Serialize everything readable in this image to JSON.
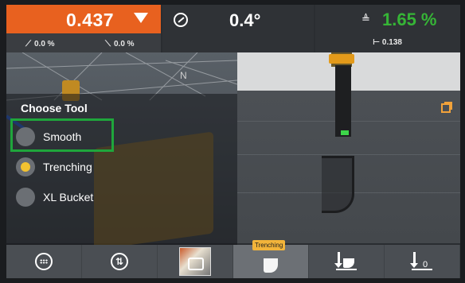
{
  "status_bar": {
    "elevation_value": "0.437",
    "cross_slope_left": "0.0 %",
    "cross_slope_right": "0.0 %",
    "heading_value": "0.4°",
    "grade_value": "1.65 %",
    "cross_distance": "0.138"
  },
  "view": {
    "north_label": "N"
  },
  "tool_menu": {
    "title": "Choose Tool",
    "options": [
      {
        "label": "Smooth",
        "selected": false
      },
      {
        "label": "Trenching",
        "selected": true
      },
      {
        "label": "XL Bucket",
        "selected": false
      }
    ]
  },
  "toolbar": {
    "active_tag": "Trenching"
  },
  "colors": {
    "elevation_header": "#e8611f",
    "grade_text": "#36b536",
    "highlight": "#1fa63c",
    "selected_radio": "#f2c230"
  },
  "icons": [
    "compass-icon",
    "grade-icon",
    "external-link-icon",
    "keyboard-icon",
    "up-down-icon",
    "map-thumbnail-icon",
    "trench-bucket-icon",
    "dig-bucket-icon",
    "dig-zero-icon"
  ]
}
